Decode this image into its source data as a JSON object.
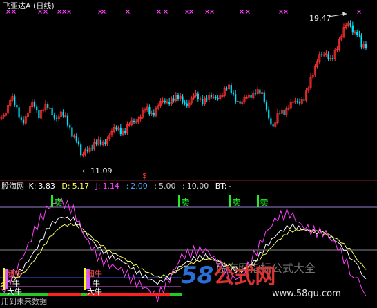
{
  "title": "飞亚达A (日线)",
  "price_chart": {
    "high_label": "19.47",
    "low_label": "11.09",
    "ylim": [
      10.0,
      20.5
    ]
  },
  "indicator": {
    "name": "股海网",
    "params": [
      {
        "label": "K:",
        "value": "3.83",
        "color": "#ffffff"
      },
      {
        "label": "D:",
        "value": "5.17",
        "color": "#ffff00"
      },
      {
        "label": "J:",
        "value": "1.14",
        "color": "#ff40ff"
      },
      {
        "label": ":",
        "value": "2.00",
        "color": "#4aa3ff"
      },
      {
        "label": ":",
        "value": "5.00",
        "color": "#cfcfcf"
      },
      {
        "label": ":",
        "value": "10.00",
        "color": "#cfcfcf"
      },
      {
        "label": "BT:",
        "value": "-",
        "color": "#ffffff"
      }
    ],
    "markers": {
      "sell": "卖",
      "super_bull": "超牛",
      "bull": "牛",
      "big_bull": "大牛"
    }
  },
  "watermark": {
    "cn": "股海网指标公式大全",
    "logo_num": "58",
    "logo_cn": "公式网",
    "url": "www.58gu.com"
  },
  "footer": "用到未来数据",
  "colors": {
    "up": "#ff3030",
    "down": "#00e5ff",
    "k": "#ffffff",
    "d": "#ffff66",
    "j": "#ff40ff",
    "sell": "#22ee22",
    "magenta": "#ff40ff"
  },
  "chart_data": {
    "type": "line",
    "x_range": [
      0,
      182
    ],
    "series": [
      {
        "name": "K",
        "points": [
          [
            0,
            12
          ],
          [
            6,
            20
          ],
          [
            12,
            35
          ],
          [
            18,
            55
          ],
          [
            24,
            78
          ],
          [
            30,
            88
          ],
          [
            36,
            85
          ],
          [
            42,
            70
          ],
          [
            48,
            55
          ],
          [
            54,
            45
          ],
          [
            60,
            40
          ],
          [
            66,
            30
          ],
          [
            72,
            22
          ],
          [
            78,
            15
          ],
          [
            84,
            22
          ],
          [
            90,
            35
          ],
          [
            96,
            42
          ],
          [
            102,
            45
          ],
          [
            108,
            40
          ],
          [
            114,
            30
          ],
          [
            120,
            28
          ],
          [
            126,
            38
          ],
          [
            132,
            55
          ],
          [
            138,
            70
          ],
          [
            144,
            78
          ],
          [
            150,
            75
          ],
          [
            156,
            72
          ],
          [
            162,
            70
          ],
          [
            168,
            60
          ],
          [
            174,
            45
          ],
          [
            182,
            20
          ]
        ]
      },
      {
        "name": "D",
        "points": [
          [
            0,
            15
          ],
          [
            6,
            18
          ],
          [
            12,
            28
          ],
          [
            18,
            45
          ],
          [
            24,
            65
          ],
          [
            30,
            78
          ],
          [
            36,
            80
          ],
          [
            42,
            72
          ],
          [
            48,
            60
          ],
          [
            54,
            50
          ],
          [
            60,
            44
          ],
          [
            66,
            36
          ],
          [
            72,
            28
          ],
          [
            78,
            22
          ],
          [
            84,
            24
          ],
          [
            90,
            32
          ],
          [
            96,
            38
          ],
          [
            102,
            42
          ],
          [
            108,
            40
          ],
          [
            114,
            34
          ],
          [
            120,
            30
          ],
          [
            126,
            36
          ],
          [
            132,
            48
          ],
          [
            138,
            62
          ],
          [
            144,
            72
          ],
          [
            150,
            74
          ],
          [
            156,
            72
          ],
          [
            162,
            70
          ],
          [
            168,
            63
          ],
          [
            174,
            52
          ],
          [
            182,
            30
          ]
        ]
      },
      {
        "name": "J",
        "points": [
          [
            0,
            5
          ],
          [
            6,
            25
          ],
          [
            12,
            50
          ],
          [
            18,
            80
          ],
          [
            24,
            100
          ],
          [
            30,
            105
          ],
          [
            36,
            95
          ],
          [
            42,
            65
          ],
          [
            48,
            45
          ],
          [
            54,
            35
          ],
          [
            60,
            30
          ],
          [
            66,
            18
          ],
          [
            72,
            10
          ],
          [
            78,
            0
          ],
          [
            84,
            20
          ],
          [
            90,
            45
          ],
          [
            96,
            50
          ],
          [
            102,
            52
          ],
          [
            108,
            38
          ],
          [
            114,
            20
          ],
          [
            120,
            22
          ],
          [
            126,
            45
          ],
          [
            132,
            70
          ],
          [
            138,
            88
          ],
          [
            144,
            92
          ],
          [
            150,
            78
          ],
          [
            156,
            72
          ],
          [
            162,
            70
          ],
          [
            168,
            55
          ],
          [
            174,
            30
          ],
          [
            182,
            1
          ]
        ]
      }
    ],
    "ylim": [
      0,
      110
    ]
  }
}
